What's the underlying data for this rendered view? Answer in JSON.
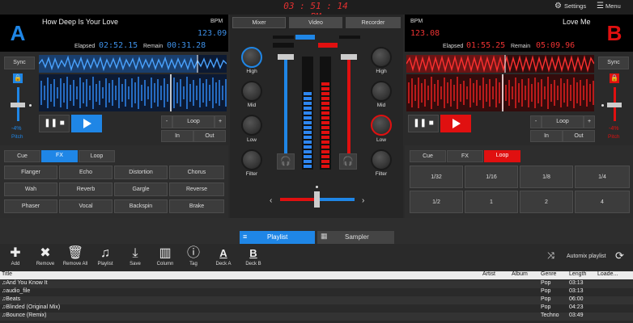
{
  "header": {
    "clock": "03 : 51 : 14 PM",
    "settings_label": "Settings",
    "menu_label": "Menu"
  },
  "colors": {
    "deck_a": "#1f86e6",
    "deck_b": "#e01010",
    "background": "#2a2a2a"
  },
  "deck_a": {
    "letter": "A",
    "title": "How Deep Is Your Love",
    "bpm_label": "BPM",
    "bpm": "123.09",
    "elapsed_label": "Elapsed",
    "elapsed": "02:52.15",
    "remain_label": "Remain",
    "remain": "00:31.28",
    "sync": "Sync",
    "pitch_value": "-4%",
    "pitch_label": "Pitch",
    "loop_minus": "-",
    "loop_label": "Loop",
    "loop_plus": "+",
    "in": "In",
    "out": "Out",
    "modes": [
      "Cue",
      "FX",
      "Loop"
    ],
    "effects": [
      "Flanger",
      "Echo",
      "Distortion",
      "Chorus",
      "Wah",
      "Reverb",
      "Gargle",
      "Reverse",
      "Phaser",
      "Vocal",
      "Backspin",
      "Brake"
    ]
  },
  "deck_b": {
    "letter": "B",
    "title": "Love Me",
    "bpm_label": "BPM",
    "bpm": "123.08",
    "elapsed_label": "Elapsed",
    "elapsed": "01:55.25",
    "remain_label": "Remain",
    "remain": "05:09.96",
    "sync": "Sync",
    "pitch_value": "-4%",
    "pitch_label": "Pitch",
    "loop_minus": "-",
    "loop_label": "Loop",
    "loop_plus": "+",
    "in": "In",
    "out": "Out",
    "modes": [
      "Cue",
      "FX",
      "Loop"
    ],
    "loops": [
      "1/32",
      "1/16",
      "1/8",
      "1/4",
      "1/2",
      "1",
      "2",
      "4"
    ]
  },
  "mixer": {
    "tabs": [
      "Mixer",
      "Video",
      "Recorder"
    ],
    "knob_labels": [
      "High",
      "Mid",
      "Low",
      "Filter"
    ]
  },
  "bottom_tabs": [
    "Playlist",
    "Sampler"
  ],
  "toolbar": {
    "items": [
      {
        "icon": "add-icon",
        "label": "Add"
      },
      {
        "icon": "remove-icon",
        "label": "Remove"
      },
      {
        "icon": "trash-icon",
        "label": "Remove All"
      },
      {
        "icon": "playlist-icon",
        "label": "Playlist"
      },
      {
        "icon": "save-icon",
        "label": "Save"
      },
      {
        "icon": "column-icon",
        "label": "Column"
      },
      {
        "icon": "info-icon",
        "label": "Tag"
      },
      {
        "icon": "deck-a-icon",
        "label": "Deck A"
      },
      {
        "icon": "deck-b-icon",
        "label": "Deck B"
      }
    ],
    "automix_label": "Automix playlist"
  },
  "playlist": {
    "columns": [
      "Title",
      "Artist",
      "Album",
      "Genre",
      "Length",
      "Loade..."
    ],
    "rows": [
      {
        "title": "And You Know It",
        "artist": "",
        "album": "",
        "genre": "Pop",
        "length": "03:13",
        "loaded": ""
      },
      {
        "title": "audio_file",
        "artist": "",
        "album": "",
        "genre": "Pop",
        "length": "03:13",
        "loaded": ""
      },
      {
        "title": "Beats",
        "artist": "",
        "album": "",
        "genre": "Pop",
        "length": "06:00",
        "loaded": ""
      },
      {
        "title": "Blinded (Original Mix)",
        "artist": "",
        "album": "",
        "genre": "Pop",
        "length": "04:23",
        "loaded": ""
      },
      {
        "title": "Bounce (Remix)",
        "artist": "",
        "album": "",
        "genre": "Techno",
        "length": "03:49",
        "loaded": ""
      }
    ]
  }
}
